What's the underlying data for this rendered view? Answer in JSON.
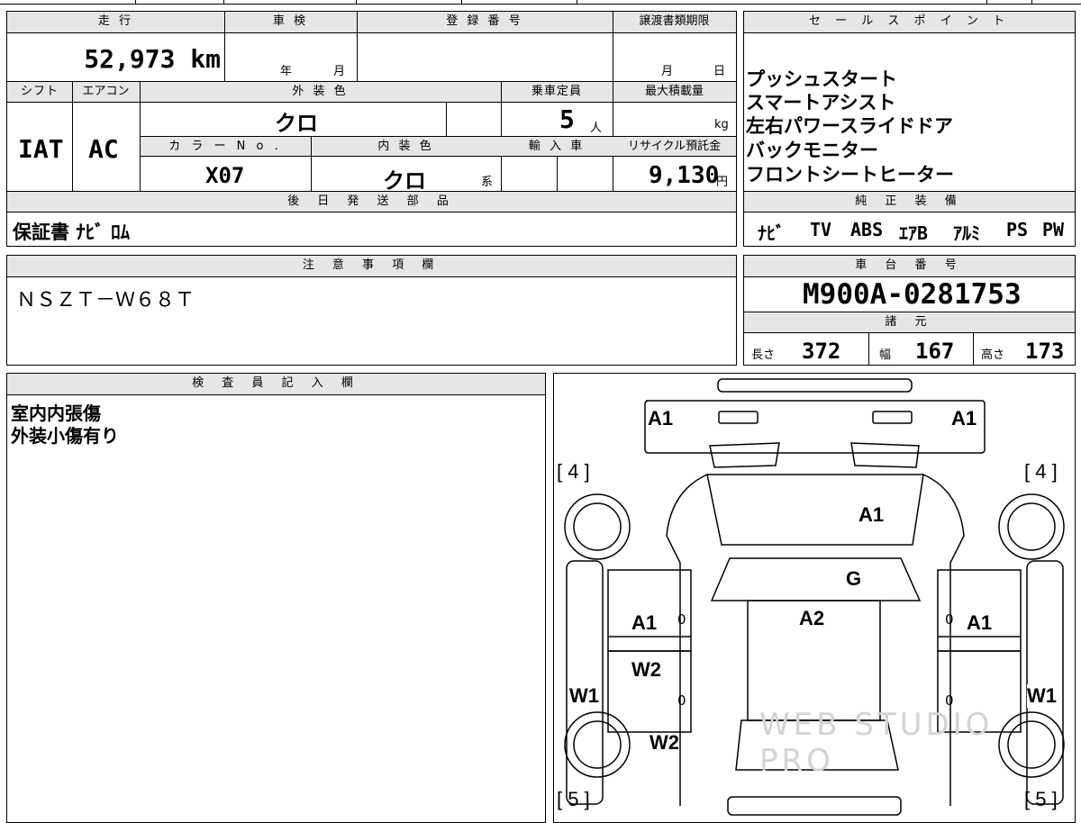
{
  "top_strip": {
    "fragment_1": "",
    "fragment_2": ""
  },
  "mileage": {
    "label": "走 行",
    "value": "52,973 km"
  },
  "inspection": {
    "label": "車 検",
    "year_unit": "年",
    "month_unit": "月"
  },
  "registration": {
    "label": "登 録 番 号",
    "value": ""
  },
  "transfer": {
    "label": "譲渡書類期限",
    "month_unit": "月",
    "day_unit": "日"
  },
  "shift": {
    "label": "シフト",
    "value": "IAT"
  },
  "aircon": {
    "label": "エアコン",
    "value": "AC"
  },
  "exterior_color": {
    "label": "外 装 色",
    "value": "クロ"
  },
  "capacity": {
    "label": "乗車定員",
    "value": "5",
    "unit": "人"
  },
  "max_load": {
    "label": "最大積載量",
    "unit": "kg"
  },
  "color_no": {
    "label": "カ ラ ー N o .",
    "value": "X07"
  },
  "interior_color": {
    "label": "内 装 色",
    "value": "クロ",
    "suffix": "系"
  },
  "import": {
    "label": "輸 入 車"
  },
  "recycle": {
    "label": "リサイクル預託金",
    "value": "9,130",
    "unit": "円"
  },
  "later_parts": {
    "label": "後 日 発 送 部 品",
    "value": "保証書 ﾅﾋﾞ ﾛﾑ"
  },
  "sales_points": {
    "label": "セ ー ル ス ポ イ ン ト",
    "items": [
      "プッシュスタート",
      "スマートアシスト",
      "左右パワースライドドア",
      "バックモニター",
      "フロントシートヒーター"
    ]
  },
  "equipment": {
    "label": "純 正 装 備",
    "items": [
      "ﾅﾋﾞ",
      "TV",
      "ABS",
      "ｴｱB",
      "ｱﾙﾐ",
      "PS",
      "PW"
    ]
  },
  "notes": {
    "label": "注 意 事 項 欄",
    "value": "ＮＳＺＴ－Ｗ６８Ｔ"
  },
  "chassis": {
    "label": "車 台 番 号",
    "value": "M900A-0281753"
  },
  "specs": {
    "label": "諸 元",
    "length_label": "長さ",
    "length": "372",
    "width_label": "幅",
    "width": "167",
    "height_label": "高さ",
    "height": "173"
  },
  "inspector": {
    "label": "検 査 員 記 入 欄",
    "lines": [
      "室内内張傷",
      "外装小傷有り"
    ]
  },
  "diagram": {
    "tire_front_left": "[ 4 ]",
    "tire_front_right": "[ 4 ]",
    "tire_rear_left": "[ 5 ]",
    "tire_rear_right": "[ 5 ]",
    "marks": {
      "front_left": "A1",
      "front_right": "A1",
      "hood": "A1",
      "windshield": "G",
      "roof": "A2",
      "front_door_left": "A1",
      "front_door_right": "A1",
      "rear_door_left": "W2",
      "rear_quarter_left": "W2",
      "sill_left": "W1",
      "sill_right": "W1",
      "zero_1": "0",
      "zero_2": "0",
      "zero_3": "0",
      "zero_4": "0"
    },
    "watermark": "WEB STUDIO PRO"
  }
}
